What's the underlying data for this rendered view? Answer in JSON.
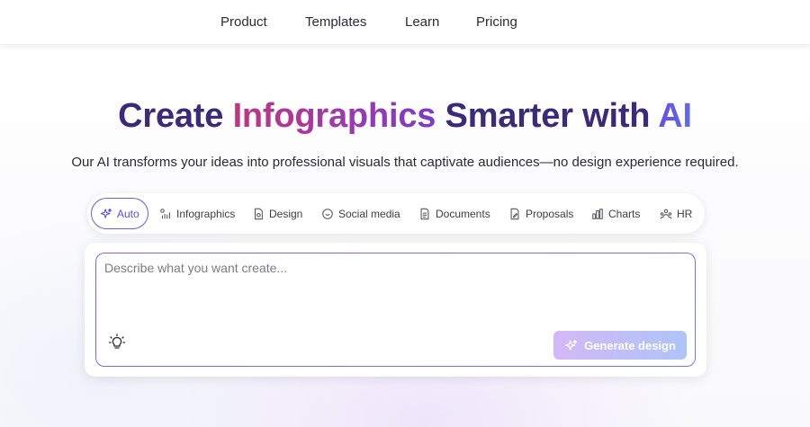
{
  "nav": {
    "items": [
      "Product",
      "Templates",
      "Learn",
      "Pricing"
    ]
  },
  "hero": {
    "title_part1": "Create ",
    "title_part2": "Infographics",
    "title_part3": " Smarter with ",
    "title_part4": "AI",
    "subtitle": "Our AI transforms your ideas into professional visuals that captivate audiences—no design experience required."
  },
  "categories": {
    "items": [
      {
        "label": "Auto",
        "icon": "sparkle-icon",
        "active": true
      },
      {
        "label": "Infographics",
        "icon": "infographic-icon",
        "active": false
      },
      {
        "label": "Design",
        "icon": "design-icon",
        "active": false
      },
      {
        "label": "Social media",
        "icon": "chat-bubble-icon",
        "active": false
      },
      {
        "label": "Documents",
        "icon": "document-icon",
        "active": false
      },
      {
        "label": "Proposals",
        "icon": "proposal-icon",
        "active": false
      },
      {
        "label": "Charts",
        "icon": "bar-chart-icon",
        "active": false
      },
      {
        "label": "HR",
        "icon": "people-icon",
        "active": false
      }
    ]
  },
  "prompt": {
    "placeholder": "Describe what you want create...",
    "value": "",
    "idea_icon": "lightbulb-icon",
    "generate_label": "Generate design"
  },
  "colors": {
    "accent": "#6b5ce7",
    "title_dark": "#3b2a7a",
    "title_pink": "#c0357f",
    "title_blue": "#6a4fe0",
    "generate_gradient_start": "#d3b8f6",
    "generate_gradient_end": "#aec4f8"
  }
}
